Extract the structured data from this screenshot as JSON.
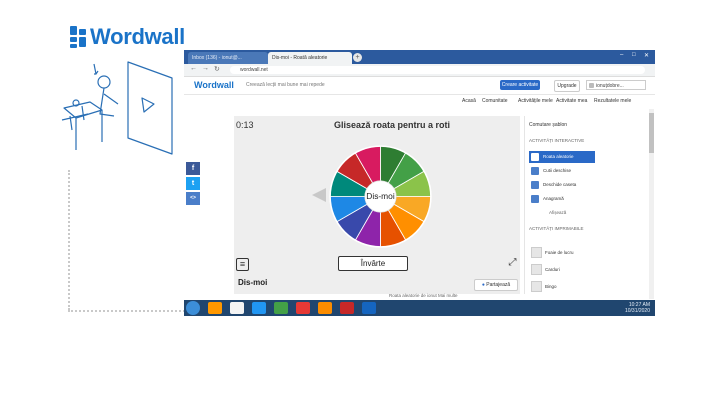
{
  "logo": {
    "text": "Wordwall",
    "color": "#1a73c8"
  },
  "browser": {
    "tabs": [
      {
        "label": "Inbox (136) - ionut@...",
        "active": false
      },
      {
        "label": "Dis-moi - Roată aleatorie",
        "active": true
      }
    ],
    "new_tab": "+",
    "url": "wordwall.net"
  },
  "site": {
    "logo": "Wordwall",
    "slogan": "Creează lecții mai bune mai repede",
    "create_button": "Creare activitate",
    "upgrade_button": "Upgrade",
    "user": "ionuțdobre...",
    "nav": [
      "Acasă",
      "Comunitate",
      "Activitățile mele",
      "Activitate mea",
      "Rezultatele mele"
    ]
  },
  "stage": {
    "timer": "0:13",
    "title": "Glisează roata pentru a roti",
    "wheel_center": "Dis-moi",
    "spin_button": "Învârte",
    "segment_colors": [
      "#2e7d32",
      "#43a047",
      "#8bc34a",
      "#f9a825",
      "#ff8f00",
      "#e65100",
      "#8e24aa",
      "#3949ab",
      "#1e88e5",
      "#00897b",
      "#c62828",
      "#d81b60"
    ]
  },
  "social": [
    "f",
    "t",
    "<>"
  ],
  "activity": {
    "title": "Dis-moi",
    "share_button": "Partajează",
    "bottom_links": "Roata aleatorie    de ionut    Mai multe"
  },
  "panel": {
    "header": "Comutare șablon",
    "interactive_label": "ACTIVITĂȚI INTERACTIVE",
    "templates": [
      {
        "label": "Roata aleatorie",
        "selected": true
      },
      {
        "label": "Cutii deschise",
        "selected": false
      },
      {
        "label": "Deschide caseta",
        "selected": false
      },
      {
        "label": "Anagramă",
        "selected": false
      }
    ],
    "more_link": "Afișează",
    "printable_label": "ACTIVITĂȚI IMPRIMABILE",
    "printables": [
      "Foaie de lucru",
      "Carduri",
      "Bingo"
    ]
  },
  "taskbar": {
    "icon_colors": [
      "#ff9800",
      "#f4f4f4",
      "#2196f3",
      "#43a047",
      "#e53935",
      "#fb8c00",
      "#c62828",
      "#1565c0"
    ],
    "clock": "10:27 AM",
    "date": "10/31/2020"
  }
}
